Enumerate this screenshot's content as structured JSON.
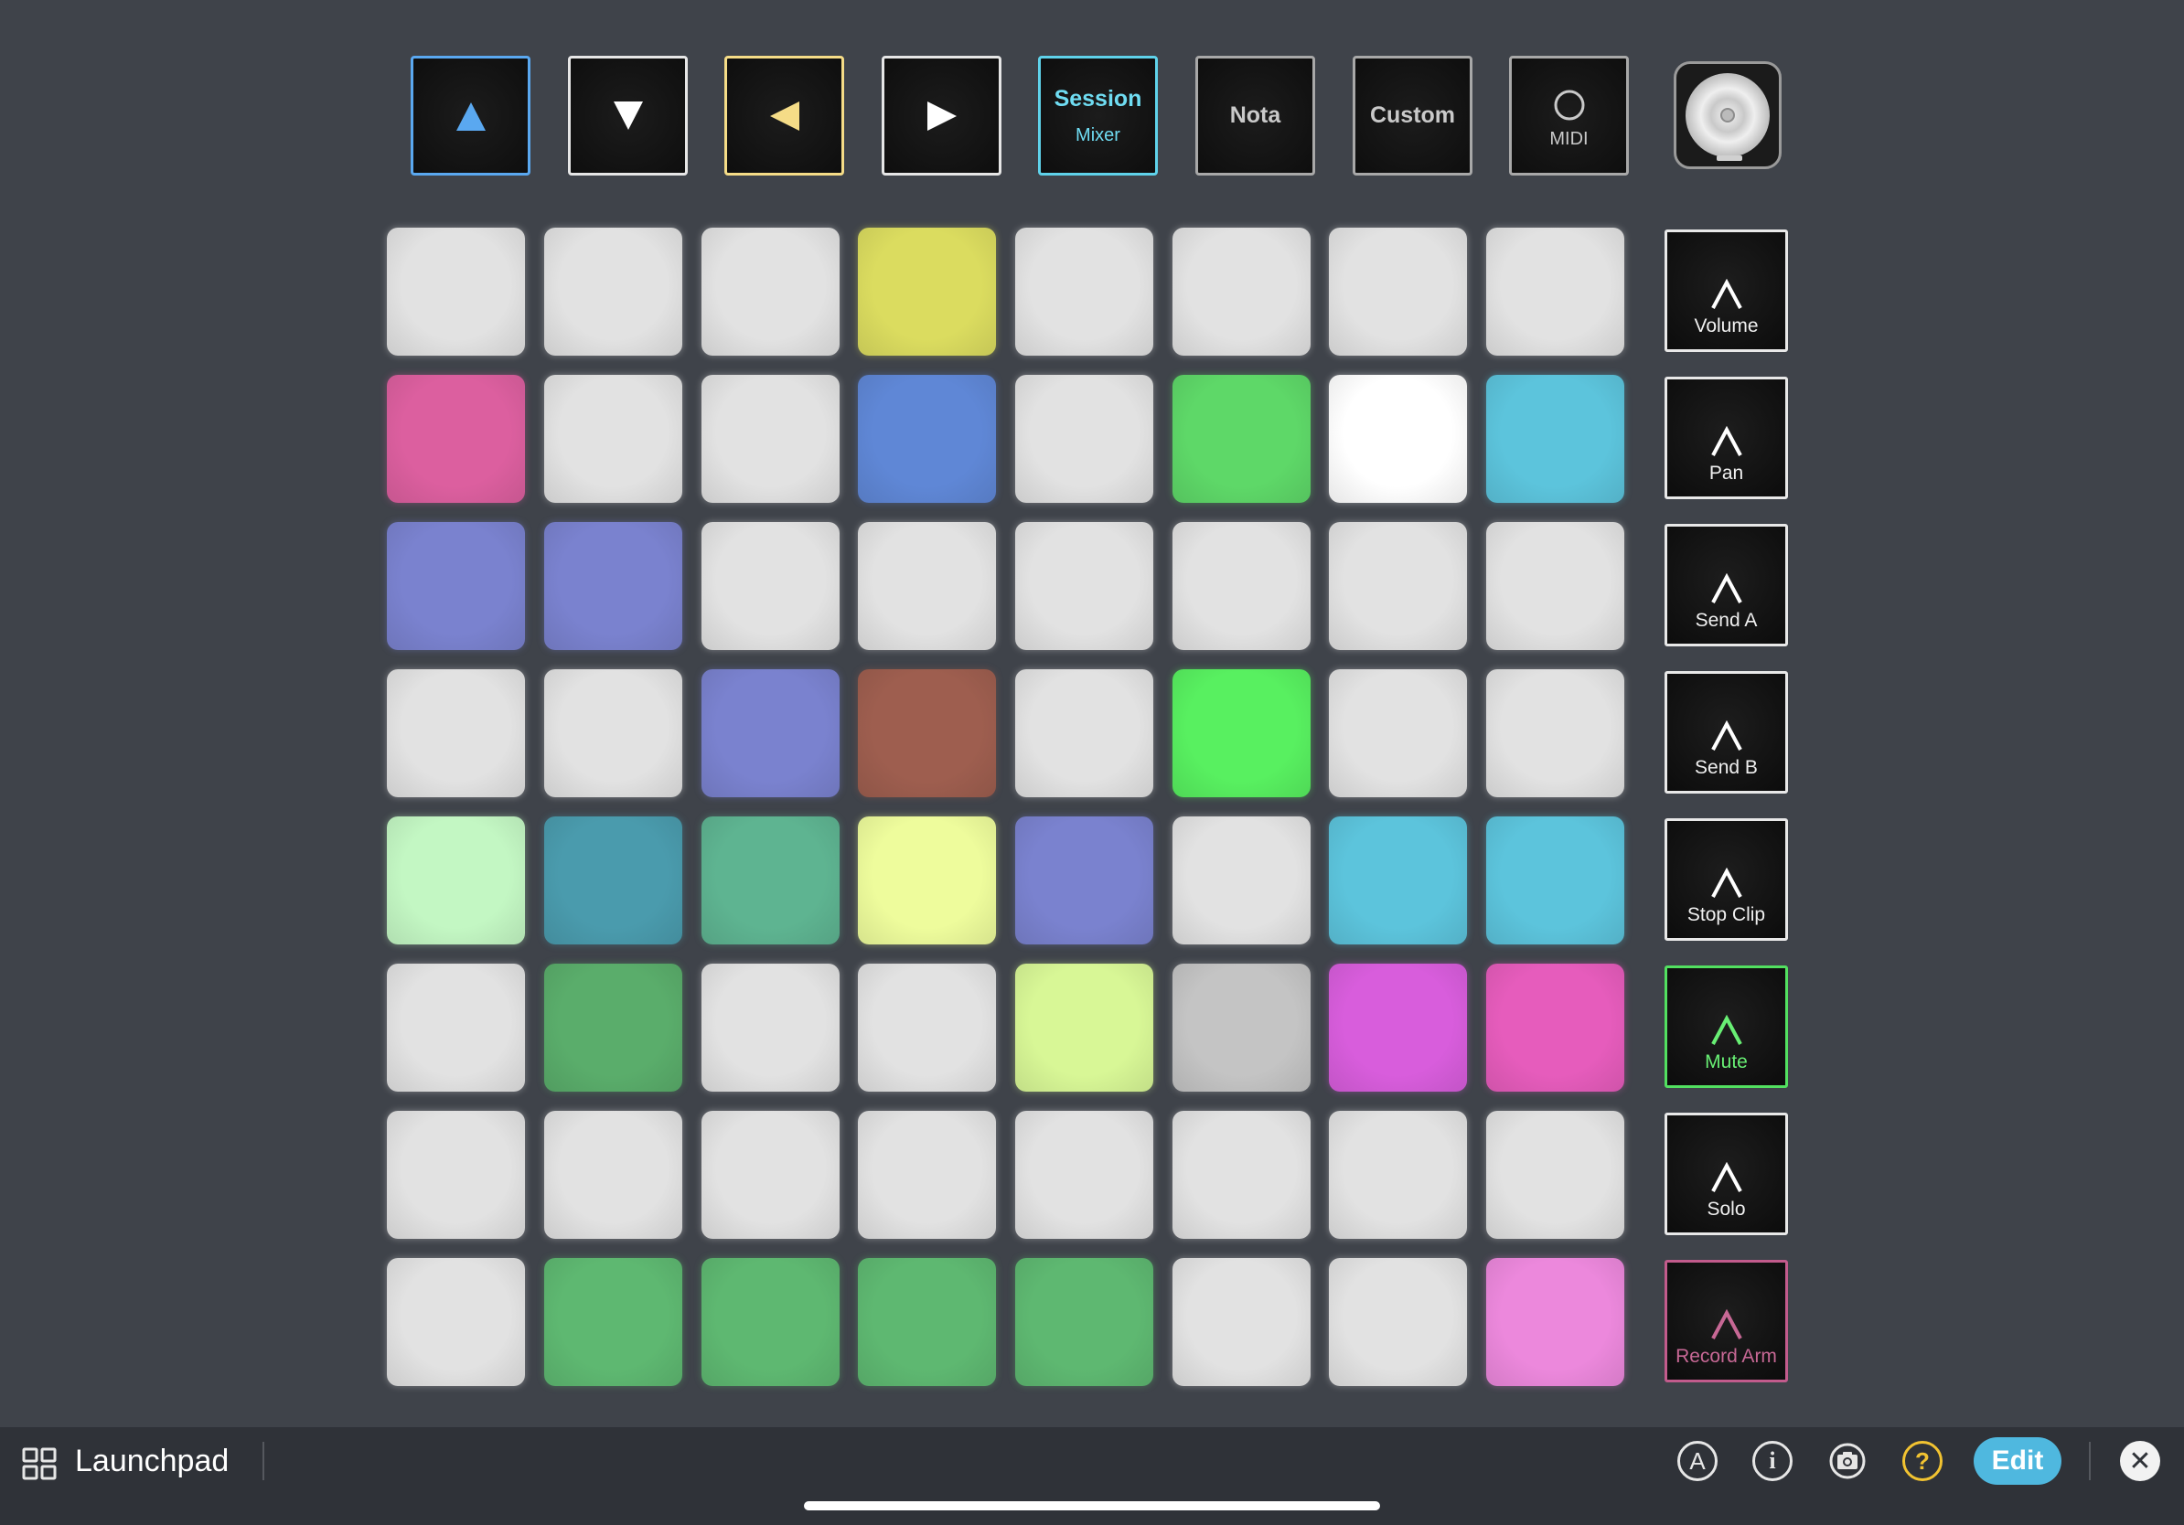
{
  "top_controls": {
    "up_label": "",
    "down_label": "",
    "left_label": "",
    "right_label": "",
    "session": {
      "label": "Session",
      "sub": "Mixer"
    },
    "note": {
      "label": "Nota"
    },
    "custom": {
      "label": "Custom"
    },
    "midi": {
      "label": "MIDI"
    }
  },
  "colors": {
    "up_arrow": "#5aa8f0",
    "left_arrow": "#f5dc87",
    "session_border": "#5fd2ea",
    "mute": "#52e060",
    "record_arm": "#c25b8c",
    "help": "#f2c331",
    "edit": "#4fb8df"
  },
  "pad_grid": [
    [
      "#e2e2e2",
      "#e2e2e2",
      "#e2e2e2",
      "#dbdc5f",
      "#e2e2e2",
      "#e2e2e2",
      "#e2e2e2",
      "#e2e2e2"
    ],
    [
      "#dc5f9f",
      "#e2e2e2",
      "#e2e2e2",
      "#5f87d6",
      "#e2e2e2",
      "#5ed868",
      "#ffffff",
      "#5cc4dc"
    ],
    [
      "#7a82cf",
      "#7a82cf",
      "#e2e2e2",
      "#e2e2e2",
      "#e2e2e2",
      "#e2e2e2",
      "#e2e2e2",
      "#e2e2e2"
    ],
    [
      "#e2e2e2",
      "#e2e2e2",
      "#7a82cf",
      "#9e5e4f",
      "#e2e2e2",
      "#58f060",
      "#e2e2e2",
      "#e2e2e2"
    ],
    [
      "#c3f7c3",
      "#4a9bad",
      "#5eb491",
      "#eefc9c",
      "#7a82cf",
      "#e2e2e2",
      "#5cc4dc",
      "#5cc4dc"
    ],
    [
      "#e2e2e2",
      "#5aad6b",
      "#e2e2e2",
      "#e2e2e2",
      "#d8f796",
      "#c4c4c4",
      "#d85ddc",
      "#e65cbc"
    ],
    [
      "#e2e2e2",
      "#e2e2e2",
      "#e2e2e2",
      "#e2e2e2",
      "#e2e2e2",
      "#e2e2e2",
      "#e2e2e2",
      "#e2e2e2"
    ],
    [
      "#e2e2e2",
      "#5eb871",
      "#5eb871",
      "#5eb871",
      "#5eb871",
      "#e2e2e2",
      "#e2e2e2",
      "#ec88dc"
    ]
  ],
  "side_buttons": [
    {
      "label": "Volume"
    },
    {
      "label": "Pan"
    },
    {
      "label": "Send A"
    },
    {
      "label": "Send B"
    },
    {
      "label": "Stop Clip"
    },
    {
      "label": "Mute"
    },
    {
      "label": "Solo"
    },
    {
      "label": "Record Arm"
    }
  ],
  "bottom_bar": {
    "app_title": "Launchpad",
    "a_icon": "A",
    "info_icon": "i",
    "help_icon": "?",
    "edit_label": "Edit",
    "close_icon": "✕"
  }
}
